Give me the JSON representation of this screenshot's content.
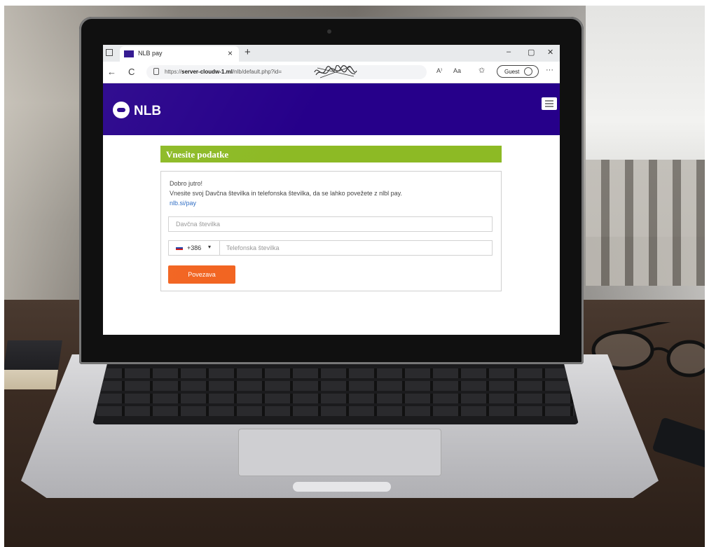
{
  "browser": {
    "tab_title": "NLB pay",
    "tab_close": "×",
    "new_tab": "+",
    "window_controls": [
      "–",
      "▢",
      "✕"
    ],
    "back": "←",
    "refresh": "C",
    "url_prefix": "https://",
    "url_host": "server-cloudw-1.ml",
    "url_path": "/nlb/default.php?id=",
    "reading_icon": "A⁾",
    "text_size_icon": "Aa",
    "favorites_icon": "✩",
    "guest_label": "Guest",
    "more_icon": "···"
  },
  "site": {
    "brand": "NLB",
    "brand_color": "#26008a",
    "accent_green": "#8dba25",
    "accent_orange": "#f26522"
  },
  "form": {
    "heading": "Vnesite podatke",
    "greeting": "Dobro jutro!",
    "instruction": "Vnesite svoj Davčna številka in telefonska številka, da se lahko povežete z nlbl pay.",
    "link": "nlb.si/pay",
    "tax_placeholder": "Davčna številka",
    "country_code": "+386",
    "phone_placeholder": "Telefonska številka",
    "submit_label": "Povezava"
  },
  "icons": {
    "app_menu": "browser-tab-square-icon",
    "lock": "lock-icon",
    "flag": "slovenia-flag-icon",
    "menu": "hamburger-menu-icon"
  }
}
